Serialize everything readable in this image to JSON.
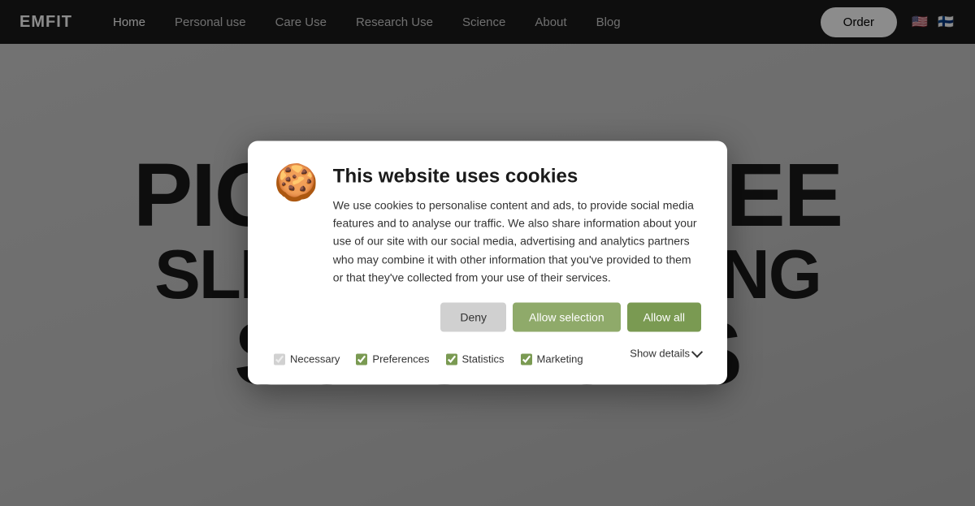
{
  "brand": {
    "logo": "EMFIT"
  },
  "nav": {
    "links": [
      {
        "label": "Home",
        "active": true
      },
      {
        "label": "Personal use",
        "active": false
      },
      {
        "label": "Care Use",
        "active": false
      },
      {
        "label": "Research Use",
        "active": false
      },
      {
        "label": "Science",
        "active": false
      },
      {
        "label": "About",
        "active": false
      },
      {
        "label": "Blog",
        "active": false
      }
    ],
    "order_label": "Order",
    "flags": [
      "🇺🇸",
      "🇫🇮"
    ]
  },
  "hero": {
    "line1": "PIONEER",
    "suffix1": "T-FREE",
    "line2": "SLEEP MONITORING",
    "line3": "SOLUTIONS"
  },
  "cookie": {
    "icon": "🍪",
    "title": "This website uses cookies",
    "body": "We use cookies to personalise content and ads, to provide social media features and to analyse our traffic. We also share information about your use of our site with our social media, advertising and analytics partners who may combine it with other information that you've provided to them or that they've collected from your use of their services.",
    "btn_deny": "Deny",
    "btn_allow_selection": "Allow selection",
    "btn_allow_all": "Allow all",
    "checkboxes": [
      {
        "label": "Necessary",
        "checked": true,
        "disabled": true
      },
      {
        "label": "Preferences",
        "checked": true
      },
      {
        "label": "Statistics",
        "checked": true
      },
      {
        "label": "Marketing",
        "checked": true
      }
    ],
    "show_details_label": "Show details",
    "chevron": "▾"
  }
}
